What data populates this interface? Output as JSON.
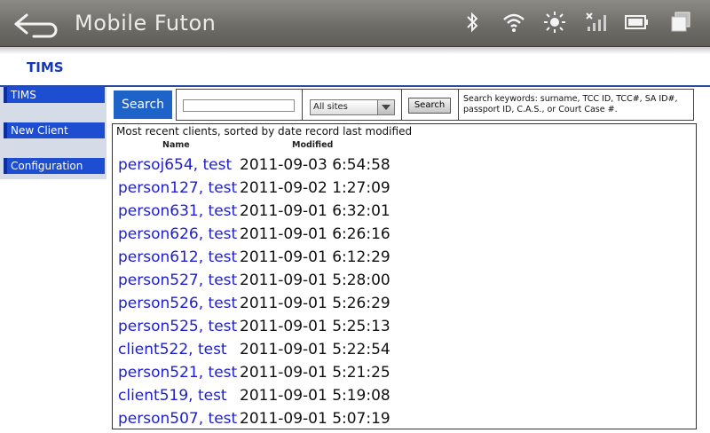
{
  "app": {
    "title": "Mobile Futon"
  },
  "header": {
    "title": "TIMS"
  },
  "sidebar": {
    "items": [
      {
        "label": "TIMS"
      },
      {
        "label": "New Client"
      },
      {
        "label": "Configuration"
      }
    ]
  },
  "search": {
    "tab_label": "Search",
    "input_value": "",
    "site_selected": "All sites",
    "button_label": "Search",
    "keywords_text": "Search keywords: surname, TCC ID, TCC#, SA ID#, passport ID, C.A.S., or Court Case #."
  },
  "results": {
    "caption": "Most recent clients, sorted by date record last modified",
    "columns": {
      "name": "Name",
      "modified": "Modified"
    },
    "rows": [
      {
        "name": "persoj654, test",
        "modified": "2011-09-03 6:54:58"
      },
      {
        "name": "person127, test",
        "modified": "2011-09-02 1:27:09"
      },
      {
        "name": "person631, test",
        "modified": "2011-09-01 6:32:01"
      },
      {
        "name": "person626, test",
        "modified": "2011-09-01 6:26:16"
      },
      {
        "name": "person612, test",
        "modified": "2011-09-01 6:12:29"
      },
      {
        "name": "person527, test",
        "modified": "2011-09-01 5:28:00"
      },
      {
        "name": "person526, test",
        "modified": "2011-09-01 5:26:29"
      },
      {
        "name": "person525, test",
        "modified": "2011-09-01 5:25:13"
      },
      {
        "name": "client522, test",
        "modified": "2011-09-01 5:22:54"
      },
      {
        "name": "person521, test",
        "modified": "2011-09-01 5:21:25"
      },
      {
        "name": "client519, test",
        "modified": "2011-09-01 5:19:08"
      },
      {
        "name": "person507, test",
        "modified": "2011-09-01 5:07:19"
      }
    ]
  },
  "status_icons": [
    "bluetooth-icon",
    "wifi-icon",
    "brightness-icon",
    "signal-icon",
    "battery-icon",
    "recent-apps-icon"
  ],
  "colors": {
    "link": "#1d1ed0",
    "accent": "#1d4ed1",
    "header_text": "#1538b8"
  }
}
